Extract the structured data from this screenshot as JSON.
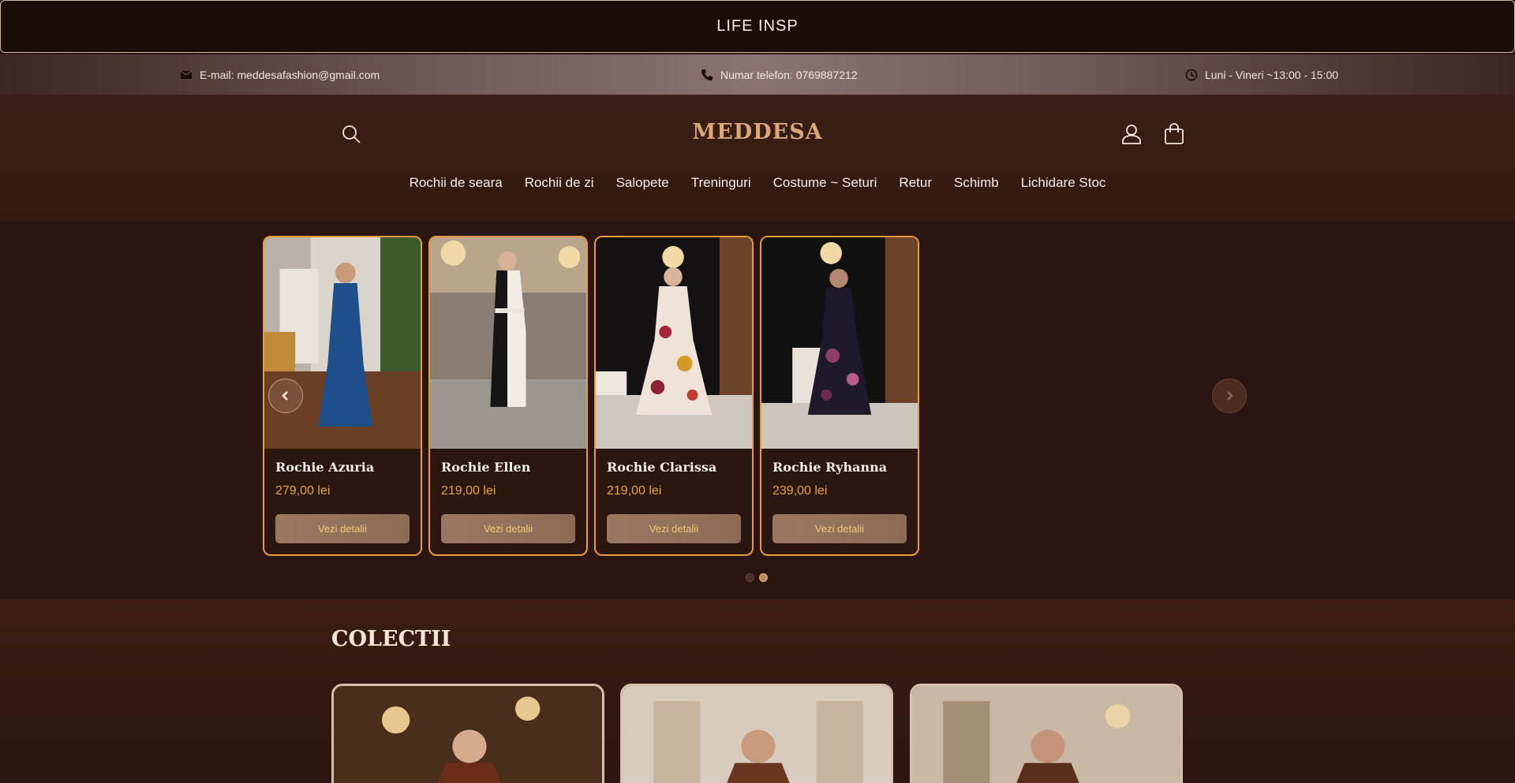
{
  "announcement": {
    "text": "LIFE INSP"
  },
  "infobar": {
    "email": "E-mail: meddesafashion@gmail.com",
    "phone": "Numar telefon: 0769887212",
    "hours": "Luni - Vineri ~13:00 - 15:00"
  },
  "header": {
    "logo": "MEDDESA",
    "nav": [
      "Rochii de seara",
      "Rochii de zi",
      "Salopete",
      "Treninguri",
      "Costume ~ Seturi",
      "Retur",
      "Schimb",
      "Lichidare Stoc"
    ]
  },
  "products": [
    {
      "name": "Rochie Azuria",
      "price": "279,00 lei",
      "button": "Vezi detalii"
    },
    {
      "name": "Rochie Ellen",
      "price": "219,00 lei",
      "button": "Vezi detalii"
    },
    {
      "name": "Rochie Clarissa",
      "price": "219,00 lei",
      "button": "Vezi detalii"
    },
    {
      "name": "Rochie Ryhanna",
      "price": "239,00 lei",
      "button": "Vezi detalii"
    }
  ],
  "carousel": {
    "active_page": 2,
    "pages": 2
  },
  "collections": {
    "title": "COLECTII"
  },
  "colors": {
    "accent": "#e89a3c",
    "price": "#e2a63c",
    "button_text": "#f3c771",
    "logo": "#d8a878"
  }
}
